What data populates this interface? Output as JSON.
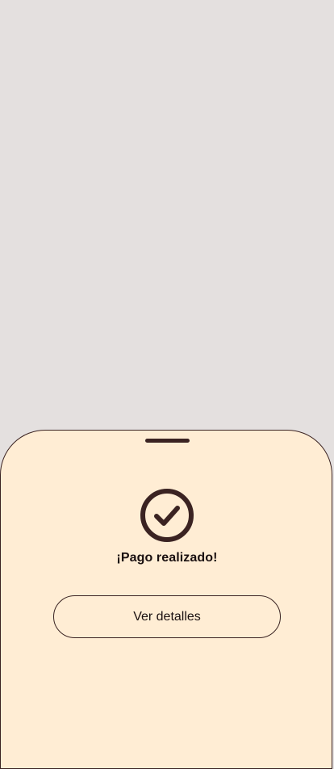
{
  "colors": {
    "backdrop": "#e4e0df",
    "sheet_background": "#ffedd4",
    "accent_dark": "#3b2322"
  },
  "bottom_sheet": {
    "icon": "check-circle-icon",
    "title": "¡Pago realizado!",
    "details_button_label": "Ver detalles"
  }
}
